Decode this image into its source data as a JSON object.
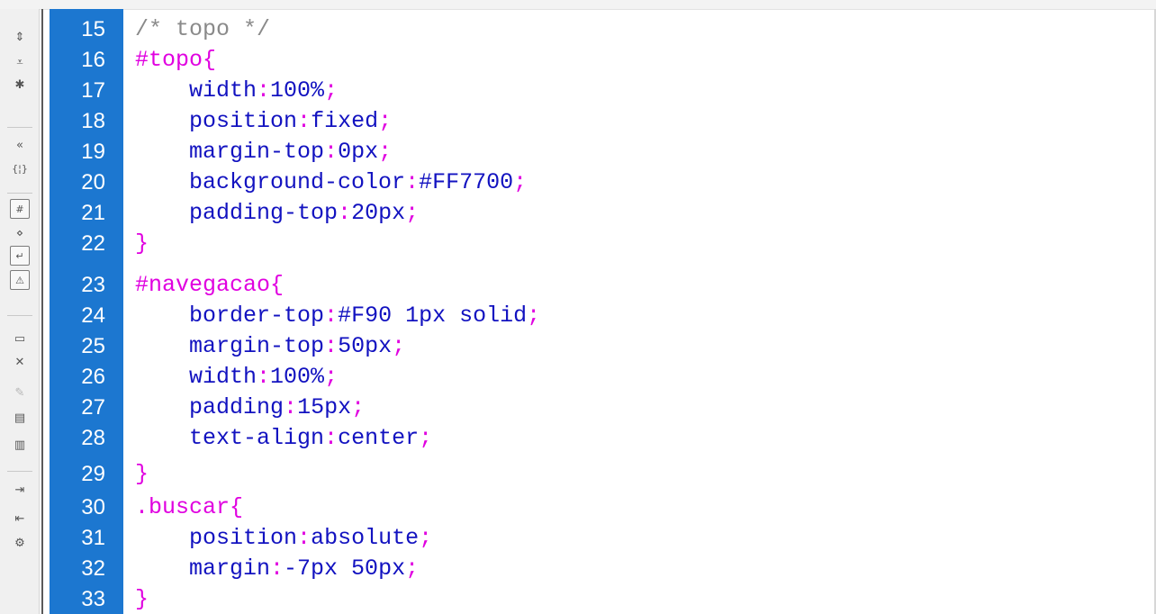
{
  "editor": {
    "lines": [
      {
        "num": "15",
        "indent": "",
        "comment": "/* topo */"
      },
      {
        "num": "16",
        "indent": "",
        "selector": "#topo",
        "brace": "{"
      },
      {
        "num": "17",
        "indent": "    ",
        "prop": "width",
        "colon": ":",
        "value": "100%",
        "semi": ";"
      },
      {
        "num": "18",
        "indent": "    ",
        "prop": "position",
        "colon": ":",
        "value": "fixed",
        "semi": ";"
      },
      {
        "num": "19",
        "indent": "    ",
        "prop": "margin-top",
        "colon": ":",
        "value": "0px",
        "semi": ";"
      },
      {
        "num": "20",
        "indent": "    ",
        "prop": "background-color",
        "colon": ":",
        "value": "#FF7700",
        "semi": ";"
      },
      {
        "num": "21",
        "indent": "    ",
        "prop": "padding-top",
        "colon": ":",
        "value": "20px",
        "semi": ";"
      },
      {
        "num": "22",
        "indent": "",
        "brace": "}"
      },
      {
        "num": "23",
        "indent": "",
        "selector": "#navegacao",
        "brace": "{"
      },
      {
        "num": "24",
        "indent": "    ",
        "prop": "border-top",
        "colon": ":",
        "value": "#F90 1px solid",
        "semi": ";"
      },
      {
        "num": "25",
        "indent": "    ",
        "prop": "margin-top",
        "colon": ":",
        "value": "50px",
        "semi": ";"
      },
      {
        "num": "26",
        "indent": "    ",
        "prop": "width",
        "colon": ":",
        "value": "100%",
        "semi": ";"
      },
      {
        "num": "27",
        "indent": "    ",
        "prop": "padding",
        "colon": ":",
        "value": "15px",
        "semi": ";"
      },
      {
        "num": "28",
        "indent": "    ",
        "prop": "text-align",
        "colon": ":",
        "value": "center",
        "semi": ";"
      },
      {
        "num": "29",
        "indent": "",
        "brace": "}"
      },
      {
        "num": "30",
        "indent": "",
        "selector": ".buscar",
        "brace": "{"
      },
      {
        "num": "31",
        "indent": "    ",
        "prop": "position",
        "colon": ":",
        "value": "absolute",
        "semi": ";"
      },
      {
        "num": "32",
        "indent": "    ",
        "prop": "margin",
        "colon": ":",
        "value": "-7px 50px",
        "semi": ";"
      },
      {
        "num": "33",
        "indent": "",
        "brace": "}"
      }
    ]
  },
  "toolbar": {
    "tools": [
      {
        "name": "collapse-full-tag-icon",
        "glyph": "⇕",
        "boxed": false,
        "disabled": false
      },
      {
        "name": "collapse-selection-icon",
        "glyph": "⩡",
        "boxed": false,
        "disabled": false
      },
      {
        "name": "expand-all-icon",
        "glyph": "✱",
        "boxed": false,
        "disabled": false
      },
      {
        "name": "select-parent-tag-icon",
        "glyph": "«",
        "boxed": false,
        "disabled": false
      },
      {
        "name": "balance-braces-icon",
        "glyph": "{¦}",
        "boxed": false,
        "disabled": false
      },
      {
        "name": "line-numbers-icon",
        "glyph": "#",
        "boxed": true,
        "disabled": false
      },
      {
        "name": "highlight-invalid-code-icon",
        "glyph": "⋄",
        "boxed": false,
        "disabled": false
      },
      {
        "name": "word-wrap-icon",
        "glyph": "↵",
        "boxed": true,
        "disabled": false
      },
      {
        "name": "syntax-error-alerts-icon",
        "glyph": "⚠",
        "boxed": true,
        "disabled": false
      },
      {
        "name": "apply-comment-icon",
        "glyph": "▭",
        "boxed": false,
        "disabled": false
      },
      {
        "name": "remove-comment-icon",
        "glyph": "✕",
        "boxed": false,
        "disabled": false
      },
      {
        "name": "wrap-tag-icon",
        "glyph": "✎",
        "boxed": false,
        "disabled": true
      },
      {
        "name": "recent-snippets-icon",
        "glyph": "▤",
        "boxed": false,
        "disabled": false
      },
      {
        "name": "move-css-icon",
        "glyph": "▥",
        "boxed": false,
        "disabled": false
      },
      {
        "name": "indent-code-icon",
        "glyph": "⇥",
        "boxed": false,
        "disabled": false
      },
      {
        "name": "outdent-code-icon",
        "glyph": "⇤",
        "boxed": false,
        "disabled": false
      },
      {
        "name": "format-source-code-icon",
        "glyph": "⚙",
        "boxed": false,
        "disabled": false
      }
    ]
  }
}
